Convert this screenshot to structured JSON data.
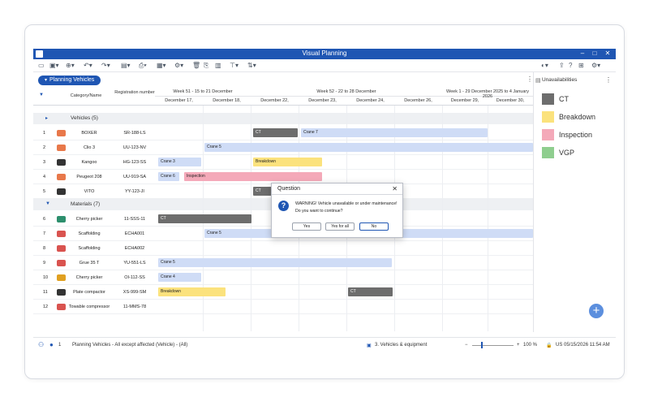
{
  "window": {
    "title": "Visual Planning"
  },
  "toolbar": {
    "icons": [
      "folder-icon",
      "new-icon",
      "add-icon",
      "undo-icon",
      "redo-icon",
      "save-icon",
      "print-icon",
      "export-icon",
      "settings-icon",
      "delete-icon",
      "copy-icon",
      "layout-icon",
      "filter-icon",
      "sort-icon"
    ]
  },
  "view_tab": {
    "label": "Planning Vehicles"
  },
  "grid": {
    "header": {
      "category": "Category/Name",
      "registration": "Registration number"
    },
    "weeks": [
      "Week 51 - 15 to 21 December",
      "Week 52 - 22 to 28 December",
      "Week 1 - 29 December 2025 to 4 January 2026"
    ],
    "days": [
      "December 17,",
      "December 18,",
      "December 22,",
      "December 23,",
      "December 24,",
      "December 26,",
      "December 29,",
      "December 30,"
    ],
    "groups": [
      {
        "name": "Vehicles (5)"
      },
      {
        "name": "Materials (7)"
      }
    ],
    "rows": [
      {
        "num": "1",
        "name": "BOXER",
        "reg": "SR-188-LS",
        "icon": "car-icon",
        "color": "#e8784a"
      },
      {
        "num": "2",
        "name": "Clio 3",
        "reg": "UU-123-NV",
        "icon": "car-icon",
        "color": "#e8784a"
      },
      {
        "num": "3",
        "name": "Kangoo",
        "reg": "HG-123-SS",
        "icon": "truck-icon",
        "color": "#333333"
      },
      {
        "num": "4",
        "name": "Peugeot 208",
        "reg": "UU-919-SA",
        "icon": "car-icon",
        "color": "#e8784a"
      },
      {
        "num": "5",
        "name": "VITO",
        "reg": "YY-123-JI",
        "icon": "van-icon",
        "color": "#333333"
      },
      {
        "num": "6",
        "name": "Cherry picker",
        "reg": "11-SSS-11",
        "icon": "tools-icon",
        "color": "#2d8f6d"
      },
      {
        "num": "7",
        "name": "Scaffolding",
        "reg": "ECHA001",
        "icon": "scaffold-icon",
        "color": "#d9534f"
      },
      {
        "num": "8",
        "name": "Scaffolding",
        "reg": "ECHA002",
        "icon": "scaffold-icon",
        "color": "#d9534f"
      },
      {
        "num": "9",
        "name": "Grue 35 T",
        "reg": "YU-551-LS",
        "icon": "crane-icon",
        "color": "#d9534f"
      },
      {
        "num": "10",
        "name": "Cherry picker",
        "reg": "OI-112-SS",
        "icon": "lift-icon",
        "color": "#e0a020"
      },
      {
        "num": "11",
        "name": "Plate compactor",
        "reg": "XS-999-SM",
        "icon": "compactor-icon",
        "color": "#333333"
      },
      {
        "num": "12",
        "name": "Towable compressor",
        "reg": "11-MMS-78",
        "icon": "compressor-icon",
        "color": "#d9534f"
      }
    ],
    "bars": [
      {
        "row": 0,
        "label": "CT",
        "type": "ct"
      },
      {
        "row": 0,
        "label": "Crane 7",
        "type": "crane"
      },
      {
        "row": 1,
        "label": "Crane 5",
        "type": "crane"
      },
      {
        "row": 2,
        "label": "Crane 3",
        "type": "crane"
      },
      {
        "row": 2,
        "label": "Breakdown",
        "type": "break"
      },
      {
        "row": 3,
        "label": "Crane 6",
        "type": "crane"
      },
      {
        "row": 3,
        "label": "Inspection",
        "type": "insp"
      },
      {
        "row": 4,
        "label": "CT",
        "type": "ct"
      },
      {
        "row": 5,
        "label": "CT",
        "type": "ct"
      },
      {
        "row": 6,
        "label": "Crane 5",
        "type": "crane"
      },
      {
        "row": 8,
        "label": "Crane 5",
        "type": "crane"
      },
      {
        "row": 9,
        "label": "Crane 4",
        "type": "crane"
      },
      {
        "row": 10,
        "label": "Breakdown",
        "type": "break"
      },
      {
        "row": 10,
        "label": "CT",
        "type": "ct"
      }
    ]
  },
  "unavailabilities": {
    "title": "Unavailabilities",
    "items": [
      {
        "label": "CT",
        "color": "#6d6d6d"
      },
      {
        "label": "Breakdown",
        "color": "#fbe27d"
      },
      {
        "label": "Inspection",
        "color": "#f4a9b9"
      },
      {
        "label": "VGP",
        "color": "#8fce8f"
      }
    ]
  },
  "dialog": {
    "title": "Question",
    "line1": "WARNING! Vehicle unavailable or under maintenance!",
    "line2": "Do you want to continue?",
    "yes": "Yes",
    "yes_all": "Yes for all",
    "no": "No"
  },
  "status": {
    "user_count": "1",
    "filter_text": "Planning Vehicles - All except affected (Vehicle) - (All)",
    "view_text": "3. Vehicles & equipment",
    "zoom": "100 %",
    "datetime": "US 05/15/2026 11:54 AM"
  }
}
